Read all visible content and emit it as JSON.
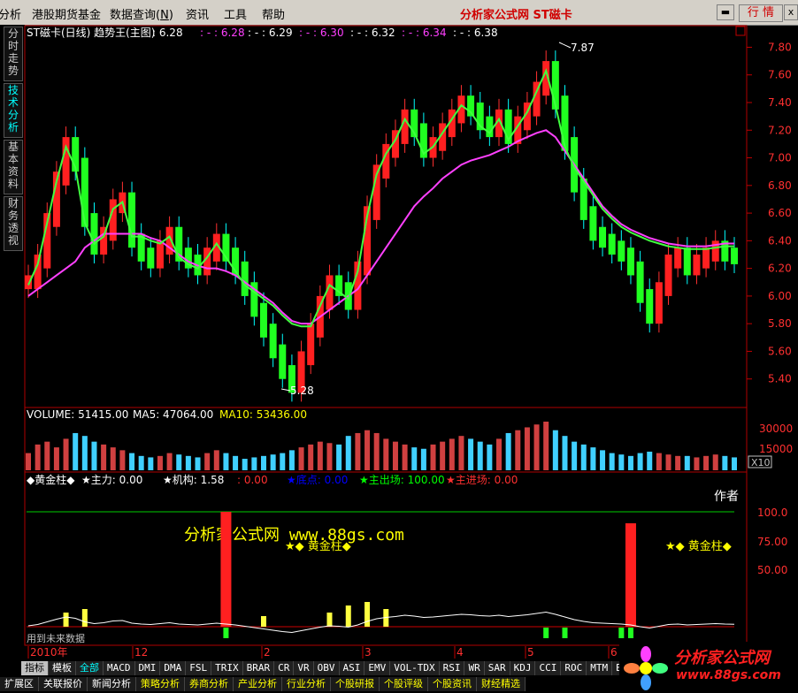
{
  "menu": {
    "items": [
      "分析",
      "港股期货基金",
      "数据查询",
      "资讯",
      "工具",
      "帮助"
    ],
    "shortcut": "N",
    "title": "分析家公式网  ST磁卡",
    "quote_button": "行 情"
  },
  "side_tabs": [
    "分时走势",
    "技术分析",
    "基本资料",
    "财务透视"
  ],
  "main_chart": {
    "header": "ST磁卡(日线) 趋势王(主图)",
    "header_values": [
      ": 6.28",
      ": - : 6.28",
      ": - : 6.29",
      ": - : 6.30",
      ": - : 6.32",
      ": - : 6.34",
      ": - : 6.38"
    ],
    "high_label": "7.87",
    "low_label": "5.28",
    "y_ticks": [
      "7.80",
      "7.60",
      "7.40",
      "7.20",
      "7.00",
      "6.80",
      "6.60",
      "6.40",
      "6.20",
      "6.00",
      "5.80",
      "5.60",
      "5.40"
    ]
  },
  "volume_panel": {
    "volume": "VOLUME: 51415.00",
    "ma5": "MA5: 47064.00",
    "ma10": "MA10: 53436.00",
    "y_ticks": [
      "30000",
      "15000"
    ],
    "unit": "X10"
  },
  "indicator_panel": {
    "items": [
      {
        "label": "◆黄金柱◆",
        "color": "#ffffff"
      },
      {
        "label": "★主力: 0.00",
        "color": "#ffffff"
      },
      {
        "label": "★机构: 1.58",
        "color": "#ffffff"
      },
      {
        "label": ": 0.00",
        "color": "#ff3030"
      },
      {
        "label": "★底点: 0.00",
        "color": "#0000ff"
      },
      {
        "label": "★主出场: 100.00",
        "color": "#00ff00"
      },
      {
        "label": "★主进场: 0.00",
        "color": "#ff3030"
      }
    ],
    "author": "作者",
    "y_ticks": [
      "100.0",
      "75.00",
      "50.00"
    ],
    "watermark": "分析家公式网 www.88gs.com",
    "golden_label_1": "★◆ 黄金柱◆",
    "golden_label_2": "★◆ 黄金柱◆",
    "future_note": "用到未来数据"
  },
  "time_axis": {
    "labels": [
      "2010年",
      "12",
      "2",
      "3",
      "4",
      "5",
      "6"
    ]
  },
  "indicator_tabs": [
    "指标",
    "模板",
    "全部",
    "MACD",
    "DMI",
    "DMA",
    "FSL",
    "TRIX",
    "BRAR",
    "CR",
    "VR",
    "OBV",
    "ASI",
    "EMV",
    "VOL-TDX",
    "RSI",
    "WR",
    "SAR",
    "KDJ",
    "CCI",
    "ROC",
    "MTM",
    "BOLL",
    "PSY"
  ],
  "bottom_tabs": [
    "扩展区",
    "关联报价",
    "新闻分析",
    "策略分析",
    "券商分析",
    "产业分析",
    "行业分析",
    "个股研报",
    "个股评级",
    "个股资讯",
    "财经精选"
  ],
  "logo": {
    "text": "分析家公式网",
    "url": "www.88gs.com"
  },
  "chart_data": {
    "type": "candlestick",
    "y_range": [
      5.2,
      7.95
    ],
    "high": 7.87,
    "low": 5.28,
    "trend_values": [
      6.1,
      6.25,
      6.55,
      6.85,
      7.1,
      6.95,
      6.55,
      6.35,
      6.45,
      6.65,
      6.7,
      6.4,
      6.3,
      6.25,
      6.35,
      6.45,
      6.3,
      6.25,
      6.2,
      6.3,
      6.4,
      6.3,
      6.2,
      6.05,
      5.9,
      5.75,
      5.6,
      5.45,
      5.35,
      5.55,
      5.75,
      5.95,
      6.1,
      6.05,
      5.95,
      6.2,
      6.6,
      6.9,
      7.05,
      7.15,
      7.3,
      7.2,
      7.05,
      7.1,
      7.2,
      7.3,
      7.4,
      7.35,
      7.25,
      7.2,
      7.3,
      7.15,
      7.25,
      7.35,
      7.5,
      7.65,
      7.4,
      7.1,
      6.8,
      6.6,
      6.45,
      6.4,
      6.35,
      6.3,
      6.2,
      6.0,
      5.85,
      6.05,
      6.25,
      6.3,
      6.2,
      6.25,
      6.3,
      6.35,
      6.3,
      6.28
    ],
    "ma_values": [
      6.0,
      6.05,
      6.1,
      6.15,
      6.2,
      6.25,
      6.35,
      6.4,
      6.45,
      6.45,
      6.45,
      6.45,
      6.45,
      6.42,
      6.4,
      6.35,
      6.3,
      6.25,
      6.22,
      6.2,
      6.2,
      6.18,
      6.15,
      6.1,
      6.05,
      6.0,
      5.95,
      5.88,
      5.82,
      5.8,
      5.8,
      5.85,
      5.9,
      5.95,
      6.0,
      6.05,
      6.15,
      6.25,
      6.35,
      6.45,
      6.55,
      6.65,
      6.72,
      6.78,
      6.85,
      6.9,
      6.95,
      6.98,
      7.0,
      7.02,
      7.05,
      7.08,
      7.12,
      7.15,
      7.18,
      7.2,
      7.15,
      7.05,
      6.95,
      6.85,
      6.75,
      6.65,
      6.58,
      6.52,
      6.48,
      6.45,
      6.42,
      6.4,
      6.38,
      6.37,
      6.36,
      6.36,
      6.36,
      6.37,
      6.38,
      6.38
    ],
    "volume_values": [
      12,
      18,
      20,
      16,
      22,
      26,
      24,
      20,
      18,
      16,
      14,
      12,
      10,
      9,
      10,
      12,
      11,
      10,
      9,
      12,
      14,
      12,
      10,
      8,
      9,
      10,
      11,
      12,
      14,
      16,
      18,
      20,
      19,
      18,
      24,
      26,
      28,
      26,
      22,
      20,
      18,
      16,
      15,
      18,
      20,
      22,
      24,
      22,
      20,
      18,
      22,
      26,
      28,
      30,
      32,
      34,
      28,
      24,
      20,
      18,
      16,
      14,
      12,
      11,
      10,
      12,
      13,
      12,
      11,
      10,
      10,
      9,
      10,
      11,
      10,
      9
    ],
    "golden_bars": [
      {
        "index": 21,
        "value": 100
      },
      {
        "index": 64,
        "value": 90
      }
    ]
  }
}
